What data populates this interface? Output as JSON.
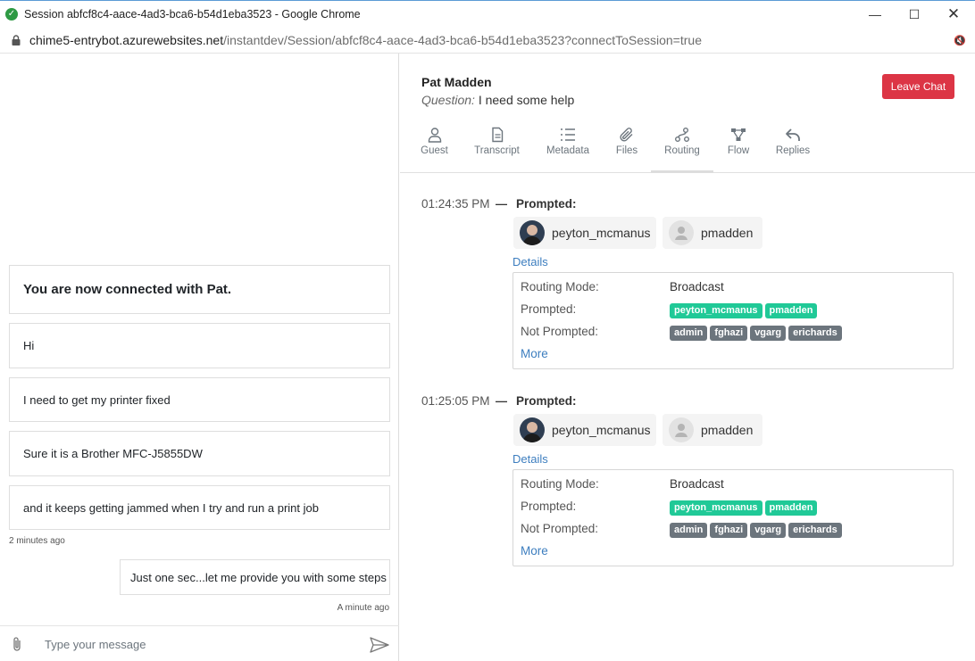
{
  "window": {
    "title": "Session abfcf8c4-aace-4ad3-bca6-b54d1eba3523 - Google Chrome"
  },
  "address": {
    "host": "chime5-entrybot.azurewebsites.net",
    "path": "/instantdev/Session/abfcf8c4-aace-4ad3-bca6-b54d1eba3523?connectToSession=true"
  },
  "chat": {
    "connected": "You are now connected with Pat.",
    "messages": [
      "Hi",
      "I need to get my printer fixed",
      "Sure it is a Brother MFC-J5855DW",
      "and it keeps getting jammed when I try and run a print job"
    ],
    "guest_ts": "2 minutes ago",
    "agent_reply": "Just one sec...let me provide you with some steps",
    "agent_ts": "A minute ago",
    "placeholder": "Type your message"
  },
  "header": {
    "name": "Pat Madden",
    "question_label": "Question:",
    "question": "I need some help",
    "leave_label": "Leave Chat"
  },
  "tabs": [
    {
      "label": "Guest",
      "icon": "user-icon"
    },
    {
      "label": "Transcript",
      "icon": "document-icon"
    },
    {
      "label": "Metadata",
      "icon": "list-icon"
    },
    {
      "label": "Files",
      "icon": "paperclip-icon"
    },
    {
      "label": "Routing",
      "icon": "route-icon"
    },
    {
      "label": "Flow",
      "icon": "flow-icon"
    },
    {
      "label": "Replies",
      "icon": "reply-icon"
    }
  ],
  "active_tab": "Routing",
  "routing": [
    {
      "time": "01:24:35 PM",
      "dash": "—",
      "label": "Prompted:",
      "users": [
        "peyton_mcmanus",
        "pmadden"
      ],
      "details_label": "Details",
      "rows": {
        "mode_label": "Routing Mode:",
        "mode": "Broadcast",
        "prompted_label": "Prompted:",
        "prompted": [
          "peyton_mcmanus",
          "pmadden"
        ],
        "not_prompted_label": "Not Prompted:",
        "not_prompted": [
          "admin",
          "fghazi",
          "vgarg",
          "erichards"
        ]
      },
      "more_label": "More"
    },
    {
      "time": "01:25:05 PM",
      "dash": "—",
      "label": "Prompted:",
      "users": [
        "peyton_mcmanus",
        "pmadden"
      ],
      "details_label": "Details",
      "rows": {
        "mode_label": "Routing Mode:",
        "mode": "Broadcast",
        "prompted_label": "Prompted:",
        "prompted": [
          "peyton_mcmanus",
          "pmadden"
        ],
        "not_prompted_label": "Not Prompted:",
        "not_prompted": [
          "admin",
          "fghazi",
          "vgarg",
          "erichards"
        ]
      },
      "more_label": "More"
    }
  ],
  "colors": {
    "leave": "#dc3545",
    "prompted_badge": "#20c997",
    "not_prompted_badge": "#6c757d",
    "link": "#3d7ebf"
  }
}
